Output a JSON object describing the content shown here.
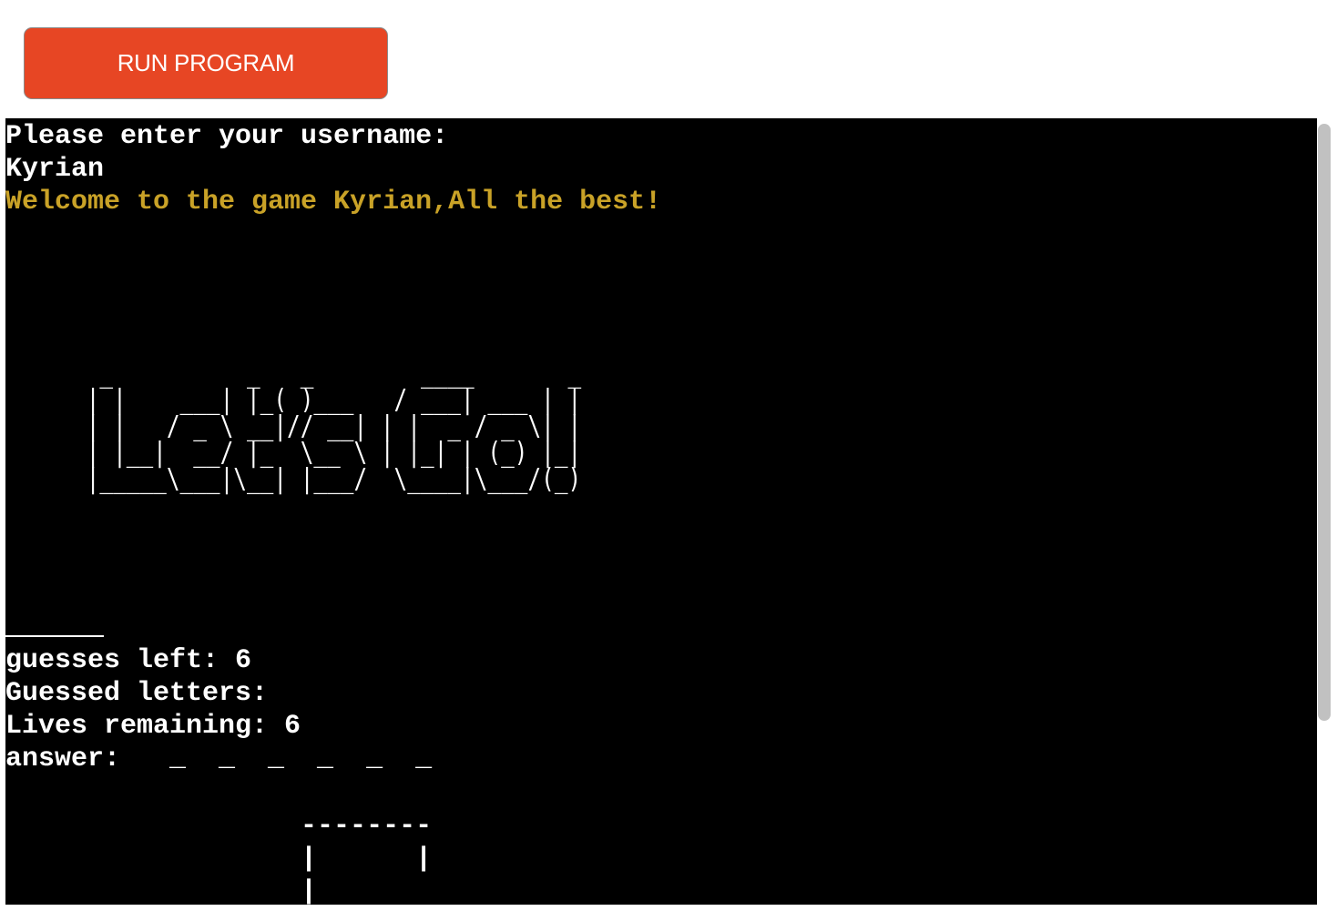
{
  "toolbar": {
    "run_label": "RUN PROGRAM",
    "accent": "#e74624"
  },
  "terminal": {
    "prompt": "Please enter your username:",
    "username": "Kyrian",
    "welcome": "Welcome to the game Kyrian,All the best!",
    "banner": "  _          _   _        ____       _ \n | |    ___| |_( )___   / ___| ___ | |\n | |   / _ \\ __|// __| | |  _ / _ \\| |\n | |__|  __/ |_  \\__ \\ | |_| | (_) |_|\n |_____\\___|\\__| |___/  \\____|\\___/(_)",
    "guesses_left": "guesses left: 6",
    "guessed_letters": "Guessed letters:",
    "lives_remaining": "Lives remaining: 6",
    "answer": "answer:   _  _  _  _  _  _",
    "hangman": "                  --------\n                  |      |\n                  |"
  },
  "colors": {
    "terminal_bg": "#000000",
    "text": "#ffffff",
    "highlight": "#c9a227"
  }
}
